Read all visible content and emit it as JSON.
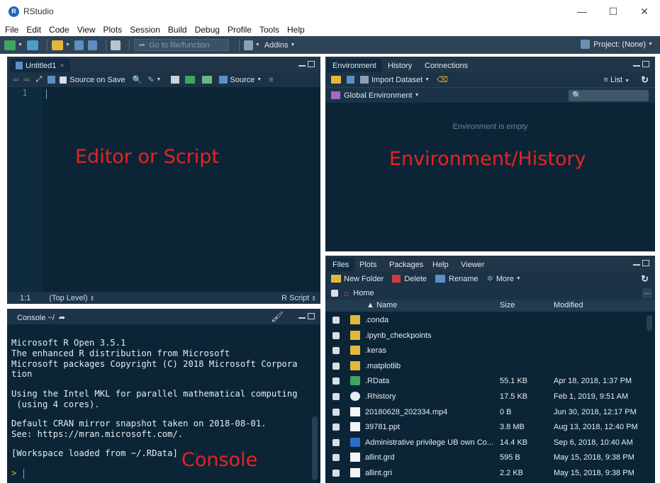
{
  "window": {
    "title": "RStudio",
    "minimize": "—",
    "maximize": "☐",
    "close": "✕"
  },
  "menu": [
    "File",
    "Edit",
    "Code",
    "View",
    "Plots",
    "Session",
    "Build",
    "Debug",
    "Profile",
    "Tools",
    "Help"
  ],
  "toolbar": {
    "goto_placeholder": "Go to file/function",
    "addins_label": "Addins",
    "project_label": "Project: (None)"
  },
  "editor": {
    "tab_label": "Untitled1",
    "source_on_save": "Source on Save",
    "source_label": "Source",
    "line_number": "1",
    "position": "1:1",
    "scope": "(Top Level)",
    "language": "R Script",
    "overlay_label": "Editor or Script"
  },
  "console": {
    "tab_label": "Console ~/",
    "lines": [
      "Microsoft R Open 3.5.1",
      "The enhanced R distribution from Microsoft",
      "Microsoft packages Copyright (C) 2018 Microsoft Corpora",
      "tion",
      "",
      "Using the Intel MKL for parallel mathematical computing",
      " (using 4 cores).",
      "",
      "Default CRAN mirror snapshot taken on 2018-08-01.",
      "See: https://mran.microsoft.com/.",
      "",
      "[Workspace loaded from ~/.RData]"
    ],
    "prompt": ">",
    "overlay_label": "Console"
  },
  "environment": {
    "tabs": [
      "Environment",
      "History",
      "Connections"
    ],
    "import_label": "Import Dataset",
    "list_label": "List",
    "scope_label": "Global Environment",
    "empty_text": "Environment is empty",
    "overlay_label": "Environment/History"
  },
  "files": {
    "tabs": [
      "Files",
      "Plots",
      "Packages",
      "Help",
      "Viewer"
    ],
    "new_folder": "New Folder",
    "delete": "Delete",
    "rename": "Rename",
    "more": "More",
    "breadcrumb": "Home",
    "ellipsis": "...",
    "columns": {
      "name": "▲ Name",
      "size": "Size",
      "modified": "Modified"
    },
    "rows": [
      {
        "name": ".conda",
        "size": "",
        "modified": "",
        "icon": "folder"
      },
      {
        "name": ".ipynb_checkpoints",
        "size": "",
        "modified": "",
        "icon": "folder"
      },
      {
        "name": ".keras",
        "size": "",
        "modified": "",
        "icon": "folder"
      },
      {
        "name": ".matplotlib",
        "size": "",
        "modified": "",
        "icon": "folder"
      },
      {
        "name": ".RData",
        "size": "55.1 KB",
        "modified": "Apr 18, 2018, 1:37 PM",
        "icon": "rdata"
      },
      {
        "name": ".Rhistory",
        "size": "17.5 KB",
        "modified": "Feb 1, 2019, 9:51 AM",
        "icon": "rhistory"
      },
      {
        "name": "20180628_202334.mp4",
        "size": "0 B",
        "modified": "Jun 30, 2018, 12:17 PM",
        "icon": "file"
      },
      {
        "name": "39781.ppt",
        "size": "3.8 MB",
        "modified": "Aug 13, 2018, 12:40 PM",
        "icon": "file"
      },
      {
        "name": "Administrative privilege UB own Co...",
        "size": "14.4 KB",
        "modified": "Sep 6, 2018, 10:40 AM",
        "icon": "word"
      },
      {
        "name": "allint.grd",
        "size": "595 B",
        "modified": "May 15, 2018, 9:38 PM",
        "icon": "file"
      },
      {
        "name": "allint.gri",
        "size": "2.2 KB",
        "modified": "May 15, 2018, 9:38 PM",
        "icon": "file"
      }
    ]
  }
}
